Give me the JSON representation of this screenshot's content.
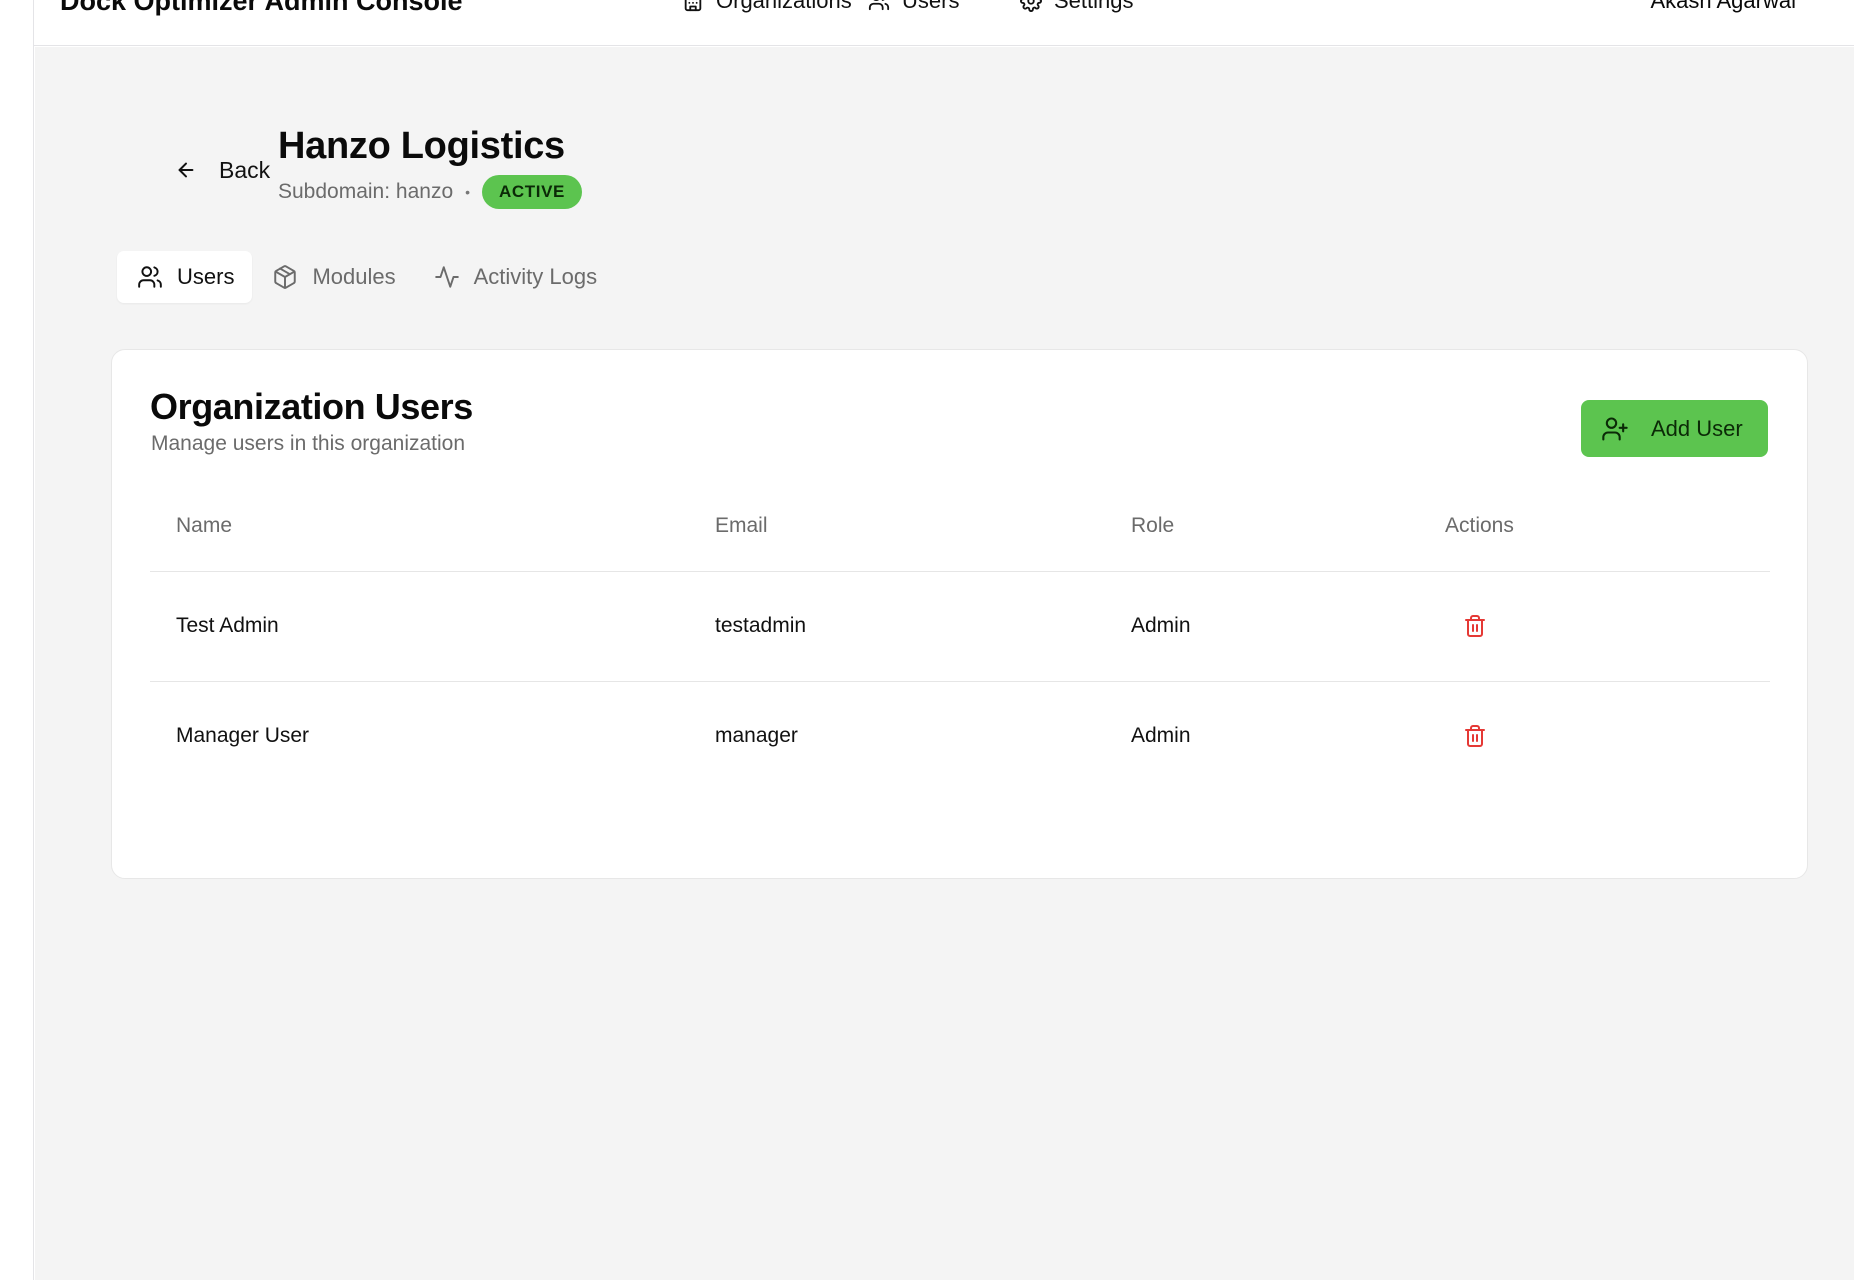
{
  "header": {
    "app_title": "Dock Optimizer Admin Console",
    "nav": [
      {
        "label": "Organizations",
        "icon": "building-icon"
      },
      {
        "label": "Users",
        "icon": "users-icon"
      },
      {
        "label": "Settings",
        "icon": "gear-icon"
      }
    ],
    "user_name": "Akash Agarwal"
  },
  "page": {
    "back_label": "Back",
    "title": "Hanzo Logistics",
    "subdomain_text": "Subdomain: hanzo",
    "separator": "•",
    "status_badge": "ACTIVE"
  },
  "tabs": [
    {
      "label": "Users",
      "icon": "users-icon",
      "active": true
    },
    {
      "label": "Modules",
      "icon": "package-icon",
      "active": false
    },
    {
      "label": "Activity Logs",
      "icon": "activity-icon",
      "active": false
    }
  ],
  "users_card": {
    "title": "Organization Users",
    "subtitle": "Manage users in this organization",
    "add_button_label": "Add User",
    "columns": [
      "Name",
      "Email",
      "Role",
      "Actions"
    ],
    "rows": [
      {
        "name": "Test Admin",
        "email": "testadmin",
        "role": "Admin",
        "action_icon": "trash-icon"
      },
      {
        "name": "Manager User",
        "email": "manager",
        "role": "Admin",
        "action_icon": "trash-icon"
      }
    ]
  },
  "colors": {
    "accent_green": "#5cc44f",
    "danger_red": "#e53935",
    "page_background": "#f4f4f4"
  }
}
